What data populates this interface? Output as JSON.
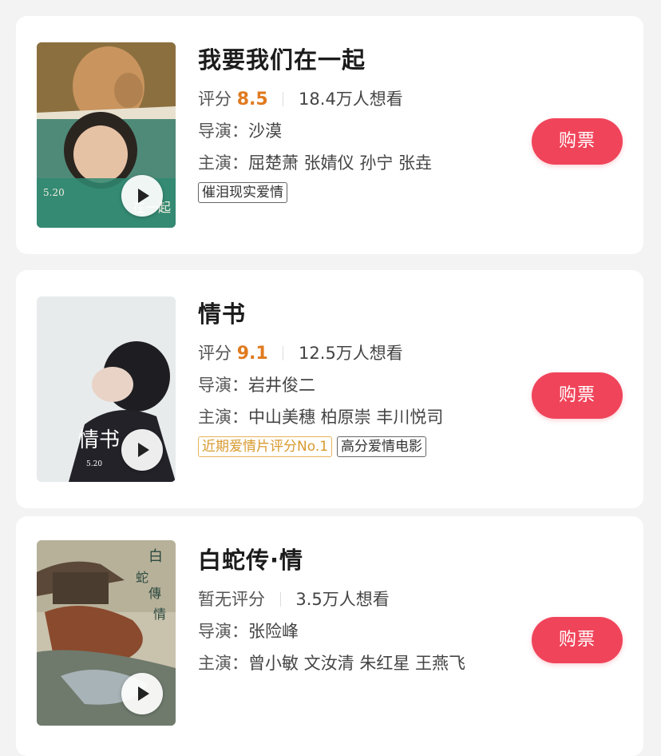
{
  "movies": [
    {
      "title": "我要我们在一起",
      "score_label": "评分",
      "score": "8.5",
      "want": "18.4万人想看",
      "director_label": "导演：",
      "director": "沙漠",
      "cast_label": "主演：",
      "cast": "屈楚萧 张婧仪 孙宁 张垚",
      "tags": [
        {
          "text": "催泪现实爱情",
          "style": "plain"
        }
      ],
      "buy_label": "购票",
      "poster_lettering": [
        "5.20",
        "在一起"
      ]
    },
    {
      "title": "情书",
      "score_label": "评分",
      "score": "9.1",
      "want": "12.5万人想看",
      "director_label": "导演：",
      "director": "岩井俊二",
      "cast_label": "主演：",
      "cast": "中山美穗 柏原崇 丰川悦司",
      "tags": [
        {
          "text": "近期爱情片评分No.1",
          "style": "gold"
        },
        {
          "text": "高分爱情电影",
          "style": "plain"
        }
      ],
      "buy_label": "购票",
      "poster_lettering": [
        "情书",
        "5.20"
      ]
    },
    {
      "title": "白蛇传·情",
      "score_label": "暂无评分",
      "score": "",
      "want": "3.5万人想看",
      "director_label": "导演：",
      "director": "张险峰",
      "cast_label": "主演：",
      "cast": "曾小敏 文汝清 朱红星 王燕飞",
      "tags": [],
      "buy_label": "购票",
      "poster_lettering": [
        "白",
        "蛇",
        "傳",
        "情"
      ]
    }
  ],
  "colors": {
    "accent_button": "#f0445a",
    "score": "#e07a1f",
    "gold_tag": "#d89a2e"
  },
  "icons": {
    "play": "play-icon"
  }
}
